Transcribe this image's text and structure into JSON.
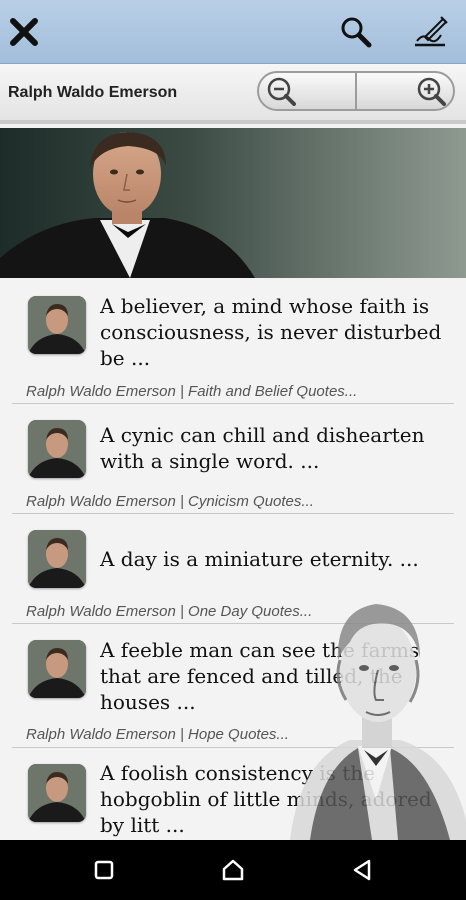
{
  "toolbar": {
    "icons": [
      "close-icon",
      "search-icon",
      "edit-icon"
    ]
  },
  "subbar": {
    "author": "Ralph Waldo Emerson",
    "zoom_icons": [
      "zoom-out-icon",
      "zoom-in-icon"
    ]
  },
  "quotes": [
    {
      "text": "A believer, a mind whose faith is consciousness, is never disturbed be ...",
      "meta": "Ralph Waldo Emerson | Faith and Belief Quotes..."
    },
    {
      "text": "A cynic can chill and dishearten with a single word. ...",
      "meta": "Ralph Waldo Emerson | Cynicism Quotes..."
    },
    {
      "text": "A day is a miniature eternity. ...",
      "meta": "Ralph Waldo Emerson | One Day Quotes..."
    },
    {
      "text": "A feeble man can see the farms that are fenced and tilled, the houses  ...",
      "meta": "Ralph Waldo Emerson | Hope Quotes..."
    },
    {
      "text": "A foolish consistency is the hobgoblin of little minds, adored by litt ...",
      "meta": ""
    }
  ],
  "navbar": {
    "icons": [
      "recent-apps-icon",
      "home-icon",
      "back-icon"
    ]
  },
  "colors": {
    "toolbar": "#a9c3de",
    "navbar": "#000000"
  }
}
